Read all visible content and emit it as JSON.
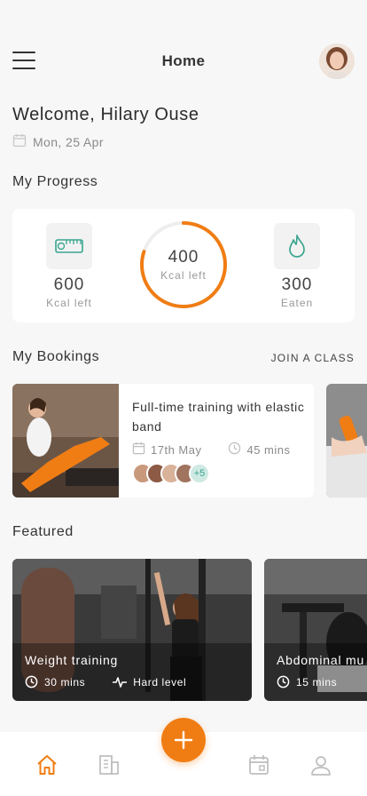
{
  "header": {
    "title": "Home",
    "menu_icon": "hamburger-menu-icon",
    "avatar_icon": "user-avatar"
  },
  "welcome": {
    "greeting": "Welcome, Hilary Ouse",
    "date": "Mon, 25 Apr",
    "date_icon": "calendar-icon"
  },
  "progress": {
    "section_title": "My Progress",
    "left": {
      "value": "600",
      "label": "Kcal left",
      "icon": "measuring-tape-icon"
    },
    "center": {
      "value": "400",
      "label": "Kcal left",
      "ring_fraction": 0.8
    },
    "right": {
      "value": "300",
      "label": "Eaten",
      "icon": "flame-icon"
    }
  },
  "bookings": {
    "section_title": "My Bookings",
    "join_label": "JOIN A CLASS",
    "items": [
      {
        "title": "Full-time training with elastic band",
        "date": "17th May",
        "duration": "45 mins",
        "more_count": "+5"
      }
    ]
  },
  "featured": {
    "section_title": "Featured",
    "items": [
      {
        "title": "Weight training",
        "duration": "30 mins",
        "level": "Hard level"
      },
      {
        "title": "Abdominal mu",
        "duration": "15 mins",
        "level": ""
      }
    ]
  },
  "nav": {
    "items": [
      "home-icon",
      "building-icon",
      "calendar-icon",
      "profile-icon"
    ],
    "fab_icon": "plus-icon"
  },
  "colors": {
    "accent": "#f07d14",
    "teal": "#3aa58f",
    "background": "#f7f7f7",
    "card": "#ffffff"
  }
}
